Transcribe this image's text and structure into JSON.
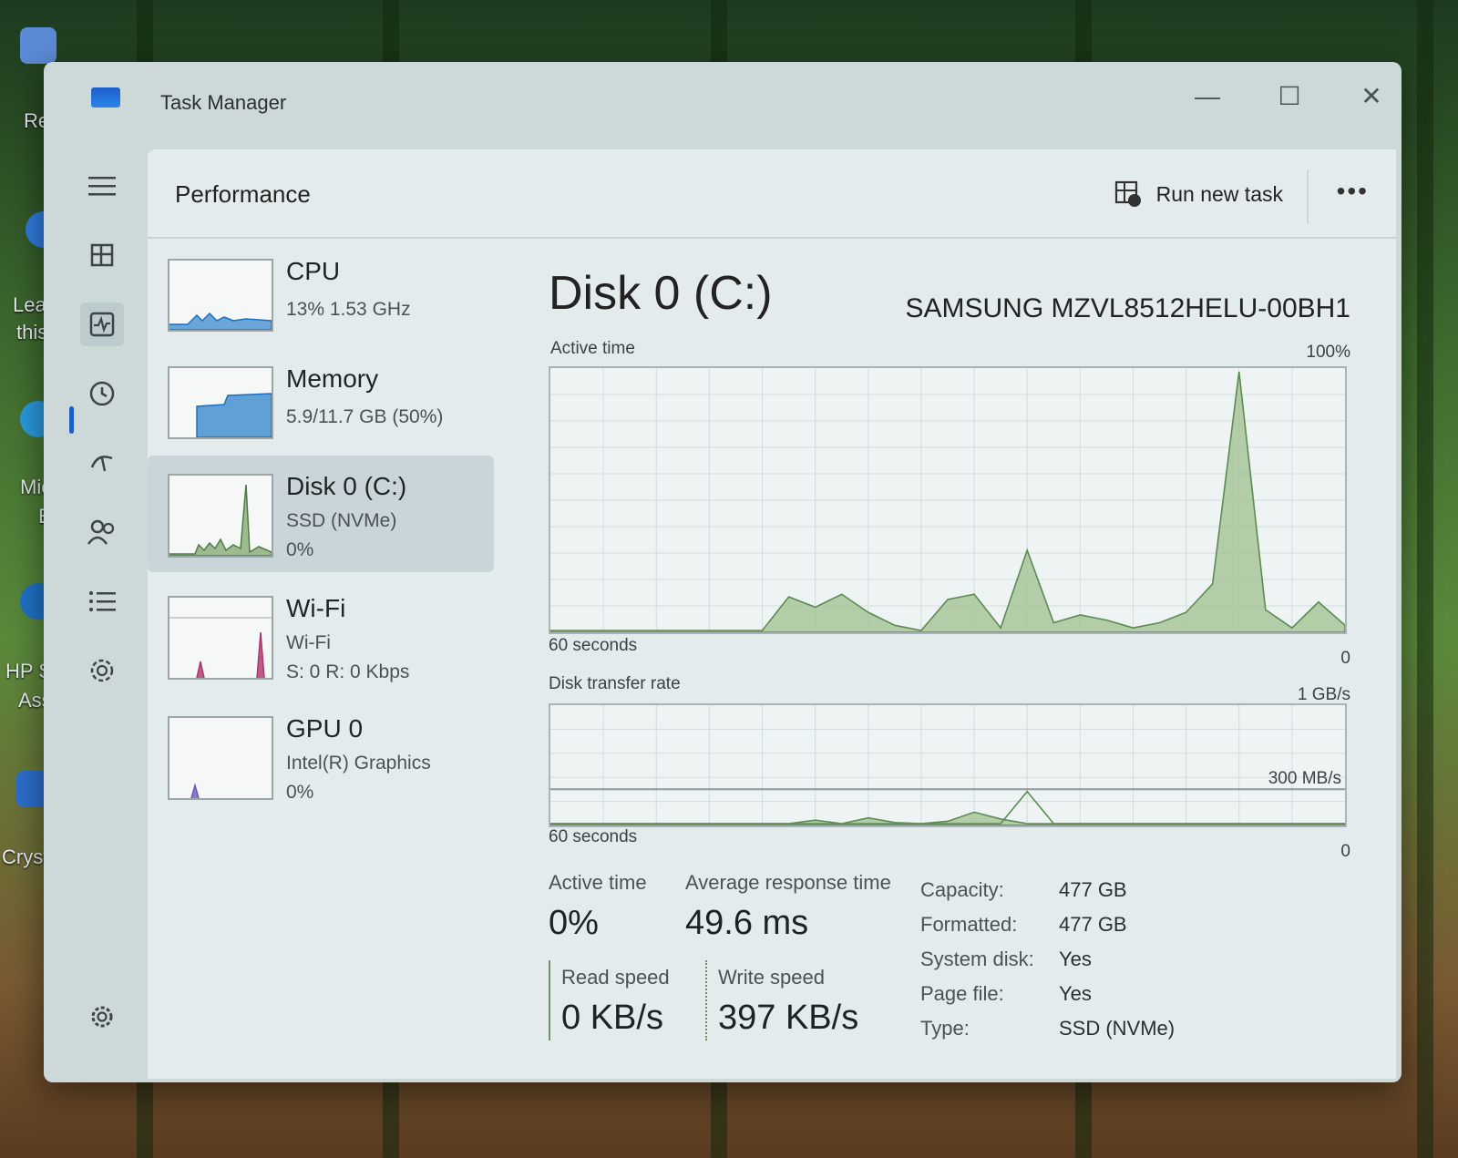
{
  "desktop": {
    "labels": [
      "Recy",
      "Learn",
      "this",
      "Mic",
      "E",
      "HP S",
      "Ass",
      "Cryst"
    ]
  },
  "window": {
    "title": "Task Manager",
    "minimize": "—",
    "maximize": "☐",
    "close": "✕"
  },
  "nav": {
    "items": [
      "menu-icon",
      "processes-icon",
      "performance-icon",
      "app-history-icon",
      "startup-apps-icon",
      "users-icon",
      "details-icon",
      "services-icon",
      "settings-icon"
    ]
  },
  "header": {
    "title": "Performance",
    "run_new_task": "Run new task",
    "more": "•••"
  },
  "sidebar": {
    "items": [
      {
        "name": "CPU",
        "sub1": "13%  1.53 GHz",
        "sub2": ""
      },
      {
        "name": "Memory",
        "sub1": "5.9/11.7 GB (50%)",
        "sub2": ""
      },
      {
        "name": "Disk 0 (C:)",
        "sub1": "SSD (NVMe)",
        "sub2": "0%"
      },
      {
        "name": "Wi-Fi",
        "sub1": "Wi-Fi",
        "sub2": "S: 0  R: 0 Kbps"
      },
      {
        "name": "GPU 0",
        "sub1": "Intel(R) Graphics",
        "sub2": "0%"
      }
    ]
  },
  "main": {
    "title": "Disk 0 (C:)",
    "model": "SAMSUNG MZVL8512HELU-00BH1",
    "active_chart": {
      "label": "Active time",
      "max_label": "100%",
      "x_label": "60 seconds",
      "min_label": "0"
    },
    "transfer_chart": {
      "label": "Disk transfer rate",
      "max_label": "1 GB/s",
      "mid_label": "300 MB/s",
      "x_label": "60 seconds",
      "min_label": "0"
    },
    "stats": {
      "active_time_label": "Active time",
      "active_time_value": "0%",
      "avg_response_label": "Average response time",
      "avg_response_value": "49.6 ms",
      "read_label": "Read speed",
      "read_value": "0 KB/s",
      "write_label": "Write speed",
      "write_value": "397 KB/s"
    },
    "props": [
      {
        "label": "Capacity:",
        "value": "477 GB"
      },
      {
        "label": "Formatted:",
        "value": "477 GB"
      },
      {
        "label": "System disk:",
        "value": "Yes"
      },
      {
        "label": "Page file:",
        "value": "Yes"
      },
      {
        "label": "Type:",
        "value": "SSD (NVMe)"
      }
    ]
  },
  "chart_data": [
    {
      "type": "area",
      "title": "Active time",
      "x": [
        0,
        2,
        4,
        6,
        8,
        10,
        12,
        14,
        16,
        18,
        20,
        22,
        24,
        26,
        28,
        30,
        32,
        34,
        36,
        38,
        40,
        42,
        44,
        46,
        48,
        50,
        52,
        54,
        56,
        58,
        60
      ],
      "series": [
        {
          "values": [
            0,
            0,
            0,
            0,
            0,
            0,
            0,
            0,
            0,
            13,
            9,
            14,
            7,
            2,
            0,
            12,
            14,
            1,
            31,
            3,
            6,
            4,
            1,
            3,
            7,
            18,
            100,
            8,
            1,
            11,
            2
          ]
        }
      ],
      "ylim": [
        0,
        100
      ],
      "xlabel": "60 seconds"
    },
    {
      "type": "area",
      "title": "Disk transfer rate",
      "x": [
        0,
        2,
        4,
        6,
        8,
        10,
        12,
        14,
        16,
        18,
        20,
        22,
        24,
        26,
        28,
        30,
        32,
        34,
        36,
        38,
        40,
        42,
        44,
        46,
        48,
        50,
        52,
        54,
        56,
        58,
        60
      ],
      "series": [
        {
          "values": [
            0,
            0,
            0,
            0,
            0,
            0,
            0,
            0,
            0,
            0,
            3,
            0,
            5,
            1,
            0,
            2,
            10,
            4,
            0,
            0,
            0,
            0,
            0,
            0,
            0,
            0,
            0,
            0,
            0,
            0,
            0
          ]
        },
        {
          "values": [
            0,
            0,
            0,
            0,
            0,
            0,
            0,
            0,
            0,
            0,
            0,
            0,
            0,
            0,
            0,
            0,
            0,
            0,
            28,
            0,
            0,
            0,
            0,
            0,
            0,
            0,
            0,
            0,
            0,
            0,
            0
          ]
        }
      ],
      "ylim": [
        0,
        100
      ],
      "xlabel": "60 seconds"
    }
  ]
}
